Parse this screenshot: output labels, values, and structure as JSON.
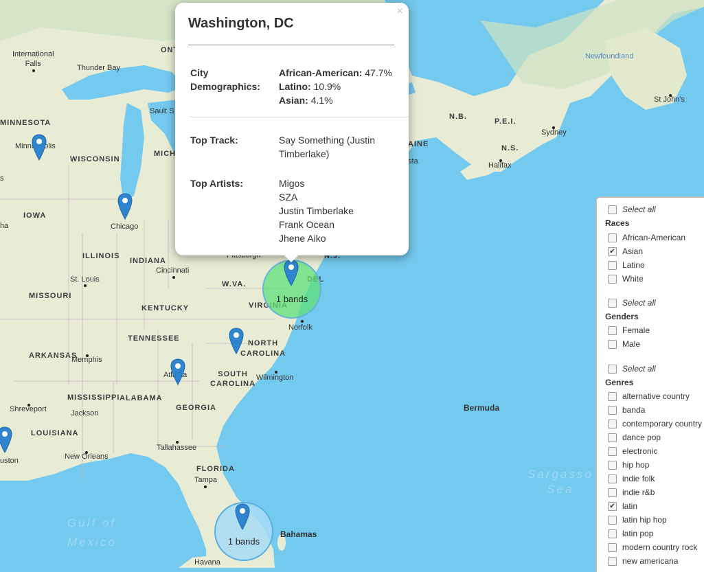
{
  "map": {
    "labels": {
      "international_falls": "International\nFalls",
      "thunder_bay": "Thunder Bay",
      "ontario": "ONT",
      "minnesota": "MINNESOTA",
      "minneapolis": "Minneapolis",
      "wisconsin": "WISCONSIN",
      "michigan": "MICH",
      "sault": "Sault S",
      "iowa": "IOWA",
      "chicago": "Chicago",
      "illinois": "ILLINOIS",
      "indiana": "INDIANA",
      "cincinnati": "Cincinnati",
      "st_louis": "St. Louis",
      "missouri": "MISSOURI",
      "kentucky": "KENTUCKY",
      "wva": "W.VA.",
      "virginia": "VIRGINIA",
      "pittsburgh": "Pittsburgh",
      "del": "DEL",
      "nj": "N.J.",
      "norfolk": "Norfolk",
      "tennessee": "TENNESSEE",
      "north_carolina": "NORTH\nCAROLINA",
      "arkansas": "ARKANSAS",
      "memphis": "Memphis",
      "atlanta": "Atlanta",
      "south_carolina": "SOUTH\nCAROLINA",
      "wilmington": "Wilmington",
      "mississippi": "MISSISSIPPI",
      "alabama": "ALABAMA",
      "georgia": "GEORGIA",
      "shreveport": "Shreveport",
      "jackson": "Jackson",
      "louisiana": "LOUISIANA",
      "houston": "uston",
      "new_orleans": "New Orleans",
      "tallahassee": "Tallahassee",
      "florida": "FLORIDA",
      "tampa": "Tampa",
      "gulf_of_mexico": "Gulf of\nMexico",
      "bahamas": "Bahamas",
      "havana": "Havana",
      "bermuda": "Bermuda",
      "sargasso_sea": "Sargasso\nSea",
      "newfoundland": "Newfoundland",
      "st_johns": "St John's",
      "nb": "N.B.",
      "pei": "P.E.I.",
      "sydney": "Sydney",
      "ns": "N.S.",
      "halifax": "Halifax",
      "maine": "AINE",
      "boston": "sta",
      "ha": "ha",
      "s": "s"
    },
    "clusters": [
      {
        "id": "dc",
        "label": "1 bands",
        "color": "#5ee07a"
      },
      {
        "id": "miami",
        "label": "1 bands",
        "color": "#a8dcf7"
      }
    ]
  },
  "popup": {
    "close": "×",
    "title": "Washington, DC",
    "demographics_label": "City\nDemographics:",
    "demographics": [
      {
        "name": "African-American:",
        "value": "47.7%"
      },
      {
        "name": "Latino:",
        "value": "10.9%"
      },
      {
        "name": "Asian:",
        "value": "4.1%"
      }
    ],
    "top_track_label": "Top Track:",
    "top_track": "Say Something (Justin\nTimberlake)",
    "top_artists_label": "Top Artists:",
    "top_artists": [
      "Migos",
      "SZA",
      "Justin Timberlake",
      "Frank Ocean",
      "Jhene Aiko"
    ]
  },
  "filters": {
    "select_all": "Select all",
    "races": {
      "heading": "Races",
      "options": [
        {
          "label": "African-American",
          "checked": false
        },
        {
          "label": "Asian",
          "checked": true
        },
        {
          "label": "Latino",
          "checked": false
        },
        {
          "label": "White",
          "checked": false
        }
      ]
    },
    "genders": {
      "heading": "Genders",
      "options": [
        {
          "label": "Female",
          "checked": false
        },
        {
          "label": "Male",
          "checked": false
        }
      ]
    },
    "genres": {
      "heading": "Genres",
      "options": [
        {
          "label": "alternative country",
          "checked": false
        },
        {
          "label": "banda",
          "checked": false
        },
        {
          "label": "contemporary country",
          "checked": false
        },
        {
          "label": "dance pop",
          "checked": false
        },
        {
          "label": "electronic",
          "checked": false
        },
        {
          "label": "hip hop",
          "checked": false
        },
        {
          "label": "indie folk",
          "checked": false
        },
        {
          "label": "indie r&b",
          "checked": false
        },
        {
          "label": "latin",
          "checked": true
        },
        {
          "label": "latin hip hop",
          "checked": false
        },
        {
          "label": "latin pop",
          "checked": false
        },
        {
          "label": "modern country rock",
          "checked": false
        },
        {
          "label": "new americana",
          "checked": false
        }
      ]
    }
  }
}
